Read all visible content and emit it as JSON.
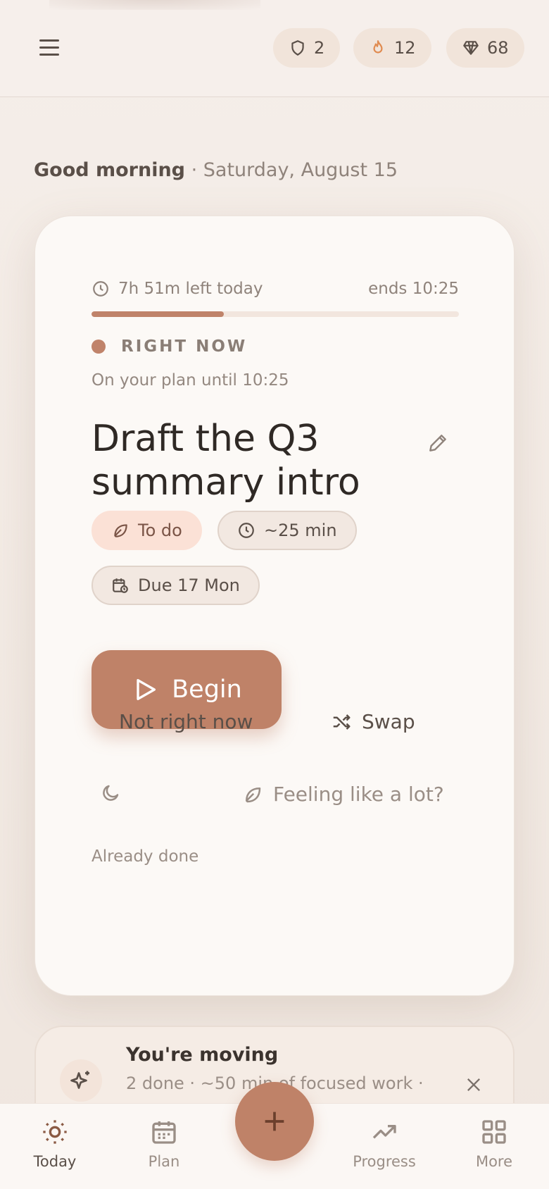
{
  "header": {
    "stats": [
      {
        "icon": "shield-icon",
        "value": "2"
      },
      {
        "icon": "flame-icon",
        "value": "12"
      },
      {
        "icon": "gem-icon",
        "value": "68"
      }
    ]
  },
  "greeting": {
    "hello": "Good morning",
    "separator": " · ",
    "date": "Saturday, August 15"
  },
  "focus_card": {
    "time_left": "7h 51m left today",
    "ends": "ends 10:25",
    "day_progress_fraction": 0.36,
    "status_label": "RIGHT NOW",
    "plan_note": "On your plan until 10:25",
    "task_title": "Draft the Q3 summary intro",
    "chips": {
      "status": "To do",
      "estimate": "~25 min",
      "due": "Due 17 Mon"
    },
    "begin_label": "Begin",
    "not_now_label": "Not right now",
    "swap_label": "Swap",
    "overwhelm_label": "Feeling like a lot?",
    "already_done_label": "Already done"
  },
  "summary_card": {
    "title": "You're moving",
    "detail": "2 done · ~50 min of focused work ·"
  },
  "bottom_nav": {
    "today": "Today",
    "plan": "Plan",
    "progress": "Progress",
    "more": "More"
  },
  "colors": {
    "accent": "#bf8268",
    "background": "#f5eee9",
    "card": "#fcf9f6",
    "todo_chip": "#fbe1d6",
    "flame": "#e08a4f"
  }
}
